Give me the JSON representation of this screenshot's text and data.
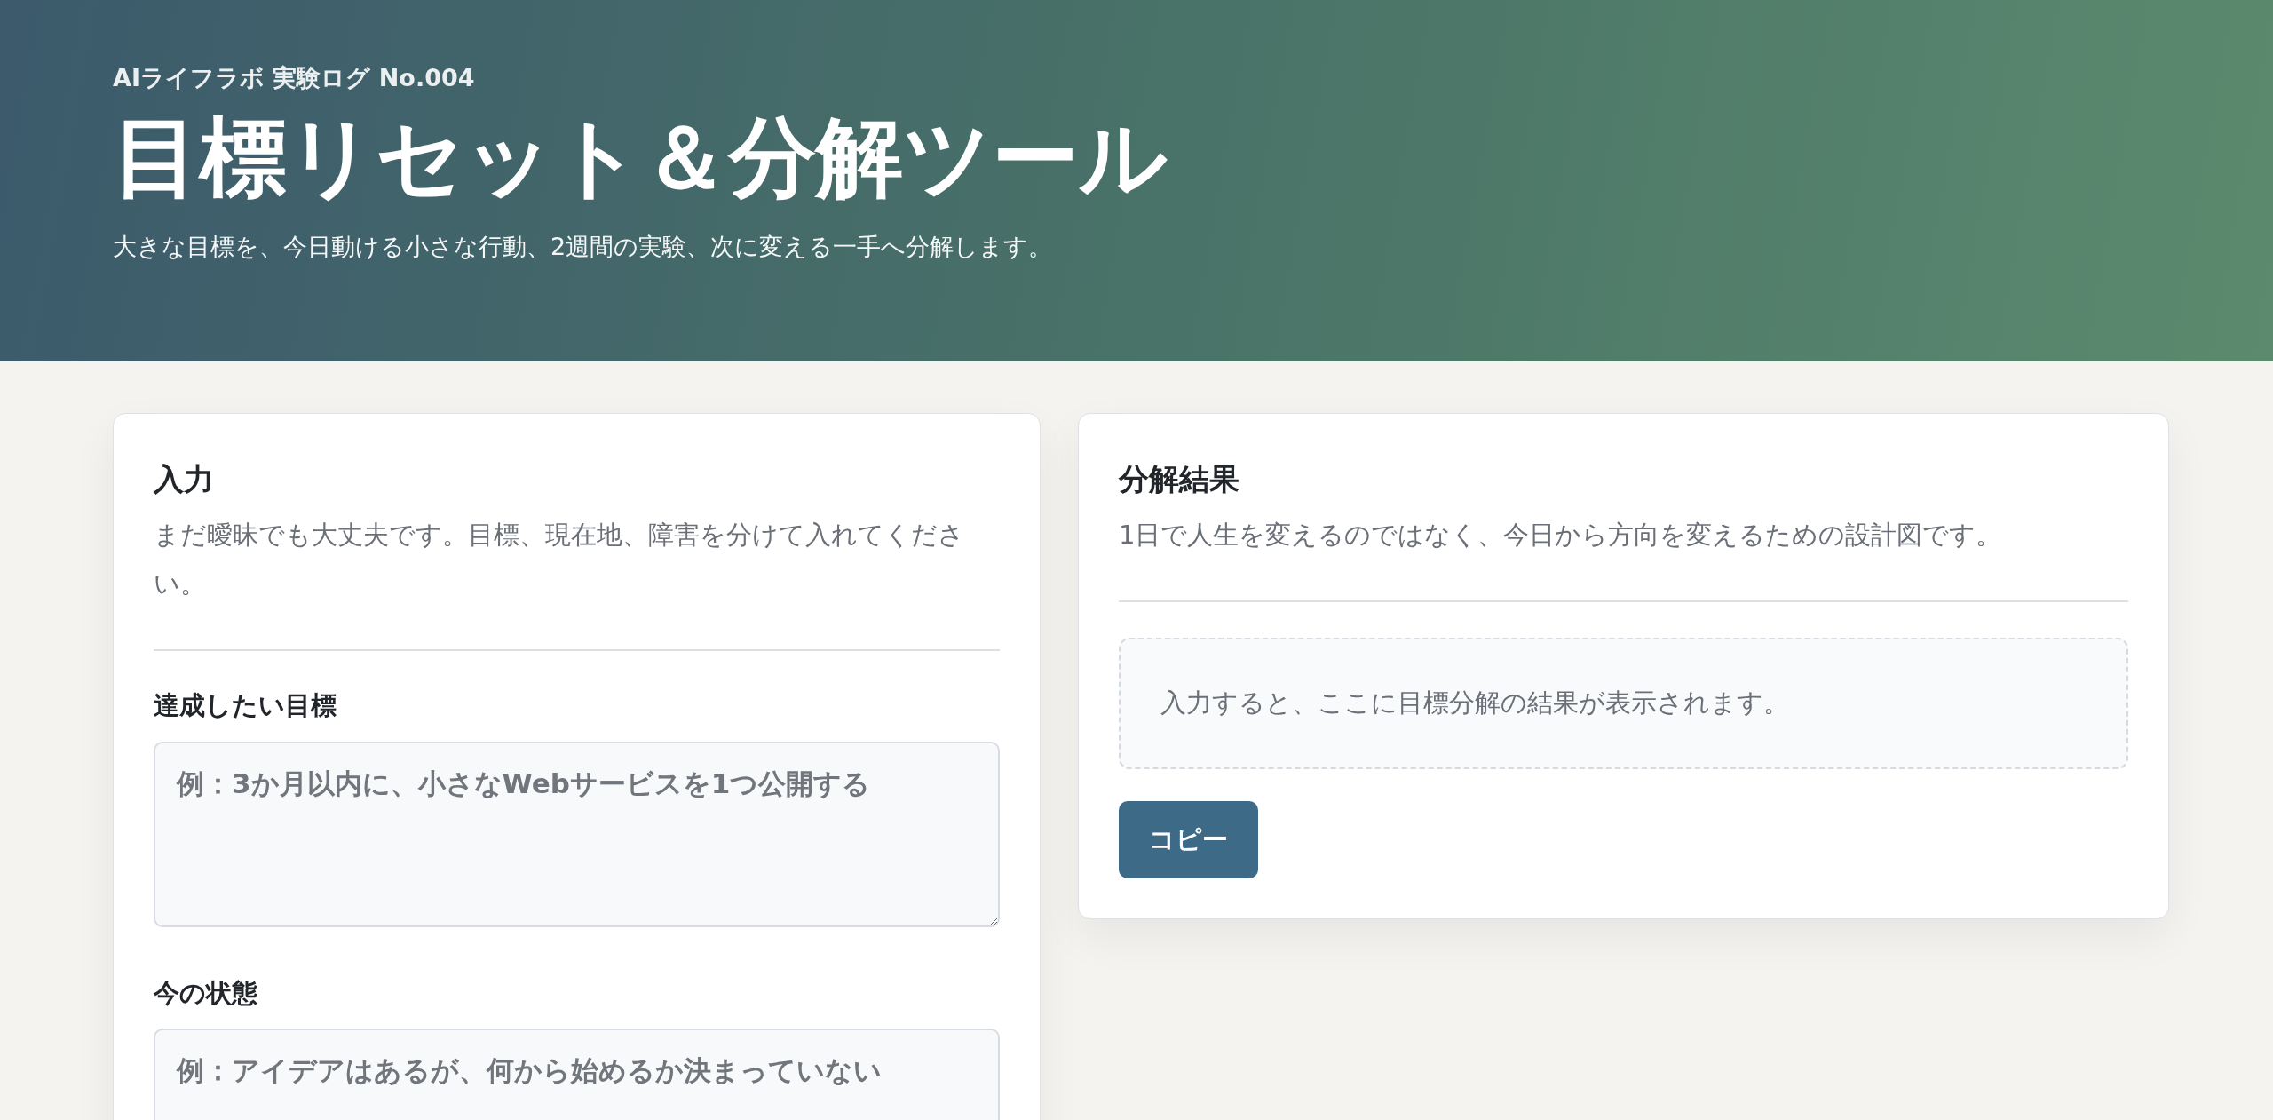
{
  "header": {
    "eyebrow": "AIライフラボ 実験ログ No.004",
    "title": "目標リセット＆分解ツール",
    "subtitle": "大きな目標を、今日動ける小さな行動、2週間の実験、次に変える一手へ分解します。"
  },
  "input_panel": {
    "heading": "入力",
    "description": "まだ曖昧でも大丈夫です。目標、現在地、障害を分けて入れてください。",
    "fields": [
      {
        "label": "達成したい目標",
        "placeholder": "例：3か月以内に、小さなWebサービスを1つ公開する"
      },
      {
        "label": "今の状態",
        "placeholder": "例：アイデアはあるが、何から始めるか決まっていない"
      }
    ]
  },
  "result_panel": {
    "heading": "分解結果",
    "description": "1日で人生を変えるのではなく、今日から方向を変えるための設計図です。",
    "empty_message": "入力すると、ここに目標分解の結果が表示されます。",
    "copy_button": "コピー"
  }
}
